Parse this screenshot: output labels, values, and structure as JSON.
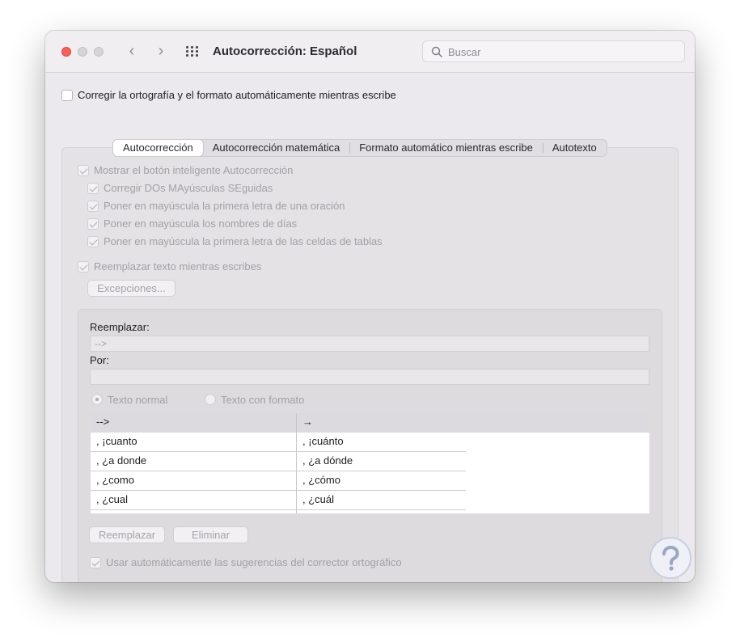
{
  "window": {
    "title": "Autocorrección: Español",
    "search_placeholder": "Buscar"
  },
  "main": {
    "top_checkbox_label": "Corregir la ortografía y el formato automáticamente mientras escribe",
    "tabs": [
      {
        "label": "Autocorrección",
        "selected": true
      },
      {
        "label": "Autocorrección matemática",
        "selected": false
      },
      {
        "label": "Formato automático mientras escribe",
        "selected": false
      },
      {
        "label": "Autotexto",
        "selected": false
      }
    ],
    "smart_button_label": "Mostrar el botón inteligente Autocorrección",
    "options": [
      "Corregir DOs MAyúsculas SEguidas",
      "Poner en mayúscula la primera letra de una oración",
      "Poner en mayúscula los nombres de días",
      "Poner en mayúscula la primera letra de las celdas de tablas"
    ],
    "replace_while_typing_label": "Reemplazar texto mientras escribes",
    "exceptions_button": "Excepciones...",
    "replace_label": "Reemplazar:",
    "replace_value": "-->",
    "with_label": "Por:",
    "with_value": "",
    "radio_plain": "Texto normal",
    "radio_formatted": "Texto con formato",
    "table": {
      "header": [
        "-->",
        "→"
      ],
      "rows": [
        [
          ", ¡cuanto",
          ", ¡cuánto"
        ],
        [
          ", ¿a donde",
          ", ¿a dónde"
        ],
        [
          ", ¿como",
          ", ¿cómo"
        ],
        [
          ", ¿cual",
          ", ¿cuál"
        ]
      ]
    },
    "replace_button": "Reemplazar",
    "delete_button": "Eliminar",
    "auto_suggestions_label": "Usar automáticamente las sugerencias del corrector ortográfico"
  }
}
